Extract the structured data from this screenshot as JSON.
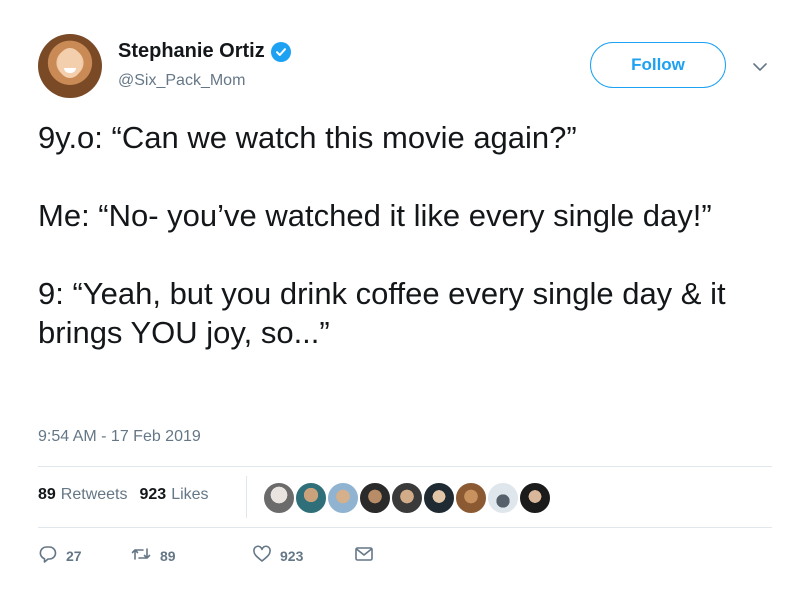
{
  "user": {
    "name": "Stephanie Ortiz",
    "handle": "@Six_Pack_Mom",
    "verified": true
  },
  "follow_label": "Follow",
  "tweet": {
    "text": "9y.o: “Can we watch this movie again?”\n\nMe: “No- you’ve watched it like every single day!”\n\n9: “Yeah, but you drink coffee every single day & it brings YOU joy, so...”",
    "timestamp": "9:54 AM - 17 Feb 2019"
  },
  "stats": {
    "retweets_count": "89",
    "retweets_label": "Retweets",
    "likes_count": "923",
    "likes_label": "Likes"
  },
  "actions": {
    "reply_count": "27",
    "retweet_count": "89",
    "like_count": "923"
  },
  "colors": {
    "accent": "#1da1f2",
    "secondary_text": "#657786",
    "primary_text": "#14171a",
    "divider": "#e1e8ed"
  },
  "icons": [
    "verified-badge-icon",
    "chevron-down-icon",
    "reply-icon",
    "retweet-icon",
    "heart-icon",
    "envelope-icon"
  ]
}
